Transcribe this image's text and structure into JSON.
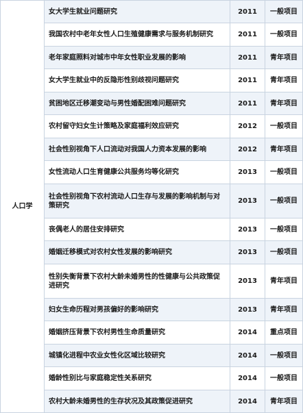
{
  "subject": "人口学",
  "rows": [
    {
      "title": "女大学生就业问题研究",
      "year": "2011",
      "type": "一般项目"
    },
    {
      "title": "我国农村中老年女性人口生殖健康需求与服务机制研究",
      "year": "2011",
      "type": "一般项目"
    },
    {
      "title": "老年家庭照料对城市中年女性职业发展的影响",
      "year": "2011",
      "type": "青年项目"
    },
    {
      "title": "女大学生就业中的反隐形性别歧视问题研究",
      "year": "2011",
      "type": "青年项目"
    },
    {
      "title": "贫困地区迁移潮变动与男性婚配困难问题研究",
      "year": "2011",
      "type": "青年项目"
    },
    {
      "title": "农村留守妇女生计策略及家庭福利效应研究",
      "year": "2012",
      "type": "一般项目"
    },
    {
      "title": "社会性别视角下人口流动对我国人力资本发展的影响",
      "year": "2012",
      "type": "青年项目"
    },
    {
      "title": "女性流动人口生育健康公共服务均等化研究",
      "year": "2013",
      "type": "一般项目"
    },
    {
      "title": "社会性别视角下农村流动人口生存与发展的影响机制与对策研究",
      "year": "2013",
      "type": "一般项目"
    },
    {
      "title": "丧偶老人的居住安排研究",
      "year": "2013",
      "type": "一般项目"
    },
    {
      "title": "婚姻迁移模式对农村女性发展的影响研究",
      "year": "2013",
      "type": "一般项目"
    },
    {
      "title": "性别失衡背景下农村大龄未婚男性的性健康与公共政策促进研究",
      "year": "2013",
      "type": "青年项目"
    },
    {
      "title": "妇女生命历程对男孩偏好的影响研究",
      "year": "2013",
      "type": "青年项目"
    },
    {
      "title": "婚姻挤压背景下农村男性生命质量研究",
      "year": "2014",
      "type": "重点项目"
    },
    {
      "title": "城镇化进程中农业女性化区域比较研究",
      "year": "2014",
      "type": "一般项目"
    },
    {
      "title": "婚龄性别比与家庭稳定性关系研究",
      "year": "2014",
      "type": "一般项目"
    },
    {
      "title": "农村大龄未婚男性的生存状况及其政策促进研究",
      "year": "2014",
      "type": "青年项目"
    }
  ]
}
